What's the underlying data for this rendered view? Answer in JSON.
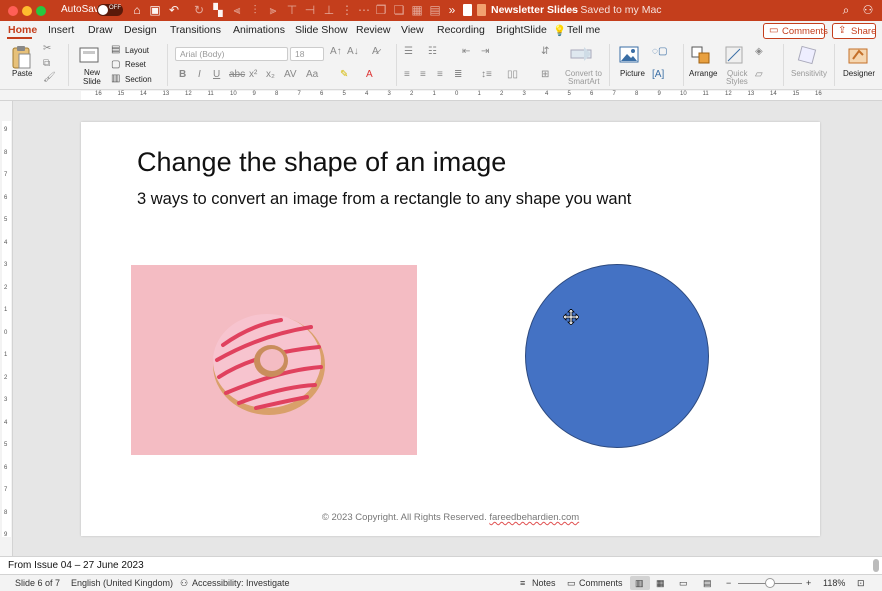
{
  "titlebar": {
    "autosave_label": "AutoSave",
    "autosave_state": "OFF",
    "doc_title": "Newsletter Slides",
    "doc_status": "— Saved to my Mac",
    "icons": [
      "home-icon",
      "save-icon",
      "undo-icon",
      "redo-icon",
      "search-icon",
      "share-people-icon"
    ]
  },
  "tabs": {
    "items": [
      "Home",
      "Insert",
      "Draw",
      "Design",
      "Transitions",
      "Animations",
      "Slide Show",
      "Review",
      "View",
      "Recording",
      "BrightSlide"
    ],
    "tell_me": "Tell me",
    "comments": "Comments",
    "share": "Share",
    "active": "Home"
  },
  "ribbon": {
    "paste": "Paste",
    "new_slide_1": "New",
    "new_slide_2": "Slide",
    "layout": "Layout",
    "reset": "Reset",
    "section": "Section",
    "font_name": "Arial (Body)",
    "font_size": "18",
    "convert_1": "Convert to",
    "convert_2": "SmartArt",
    "picture": "Picture",
    "arrange": "Arrange",
    "quick_styles_1": "Quick",
    "quick_styles_2": "Styles",
    "sensitivity": "Sensitivity",
    "designer": "Designer"
  },
  "ruler": {
    "h_ticks": [
      "16",
      "15",
      "14",
      "13",
      "12",
      "11",
      "10",
      "9",
      "8",
      "7",
      "6",
      "5",
      "4",
      "3",
      "2",
      "1",
      "0",
      "1",
      "2",
      "3",
      "4",
      "5",
      "6",
      "7",
      "8",
      "9",
      "10",
      "11",
      "12",
      "13",
      "14",
      "15",
      "16"
    ],
    "v_ticks": [
      "9",
      "8",
      "7",
      "6",
      "5",
      "4",
      "3",
      "2",
      "1",
      "0",
      "1",
      "2",
      "3",
      "4",
      "5",
      "6",
      "7",
      "8",
      "9"
    ]
  },
  "slide": {
    "title": "Change the shape of an image",
    "subtitle": "3 ways to convert an image from a rectangle to any shape you want",
    "footer_text": "© 2023 Copyright. All Rights Reserved. ",
    "footer_link": "fareedbehardien.com",
    "circle_color": "#4472c4"
  },
  "notes": {
    "text": "From Issue 04 – 27 June 2023"
  },
  "statusbar": {
    "slide_counter": "Slide 6 of 7",
    "language": "English (United Kingdom)",
    "accessibility": "Accessibility: Investigate",
    "notes": "Notes",
    "comments": "Comments",
    "zoom": "118%"
  },
  "colors": {
    "accent": "#c43e1c",
    "shape_fill": "#4472c4"
  }
}
